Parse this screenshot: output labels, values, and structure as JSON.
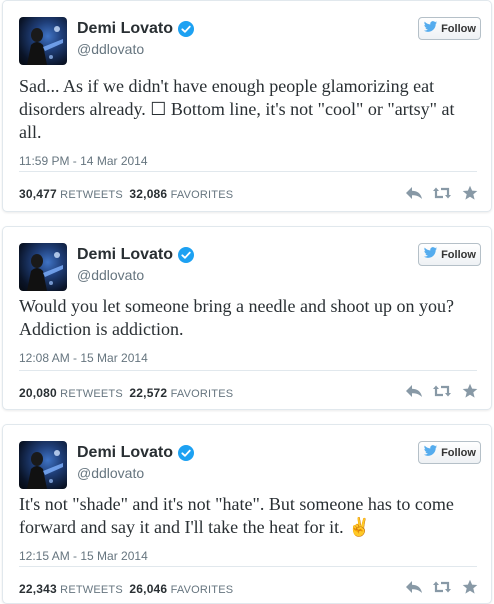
{
  "tweets": [
    {
      "name": "Demi Lovato",
      "handle": "@ddlovato",
      "follow_label": "Follow",
      "text": "Sad... As if we didn't have enough people glamorizing eat disorders already. ☐ Bottom line, it's not \"cool\" or \"artsy\" at all.",
      "timestamp": "11:59 PM - 14 Mar 2014",
      "retweets": "30,477",
      "retweets_label": "RETWEETS",
      "favorites": "32,086",
      "favorites_label": "FAVORITES"
    },
    {
      "name": "Demi Lovato",
      "handle": "@ddlovato",
      "follow_label": "Follow",
      "text": "Would you let someone bring a needle and shoot up on you? Addiction is addiction.",
      "timestamp": "12:08 AM - 15 Mar 2014",
      "retweets": "20,080",
      "retweets_label": "RETWEETS",
      "favorites": "22,572",
      "favorites_label": "FAVORITES"
    },
    {
      "name": "Demi Lovato",
      "handle": "@ddlovato",
      "follow_label": "Follow",
      "text": "It's not \"shade\" and it's not \"hate\". But someone has to come forward and say it and I'll take the heat for it. ✌",
      "timestamp": "12:15 AM - 15 Mar 2014",
      "retweets": "22,343",
      "retweets_label": "RETWEETS",
      "favorites": "26,046",
      "favorites_label": "FAVORITES"
    }
  ],
  "icons": {
    "avatar": "profile-photo",
    "verified": "verified-badge-icon",
    "follow": "twitter-bird-icon",
    "reply": "reply-icon",
    "retweet": "retweet-icon",
    "favorite": "star-icon"
  },
  "colors": {
    "verified_blue": "#1da1f2",
    "bird_blue": "#55acee",
    "text_dark": "#292f33",
    "text_muted": "#66757f",
    "action_gray": "#8899a6"
  }
}
